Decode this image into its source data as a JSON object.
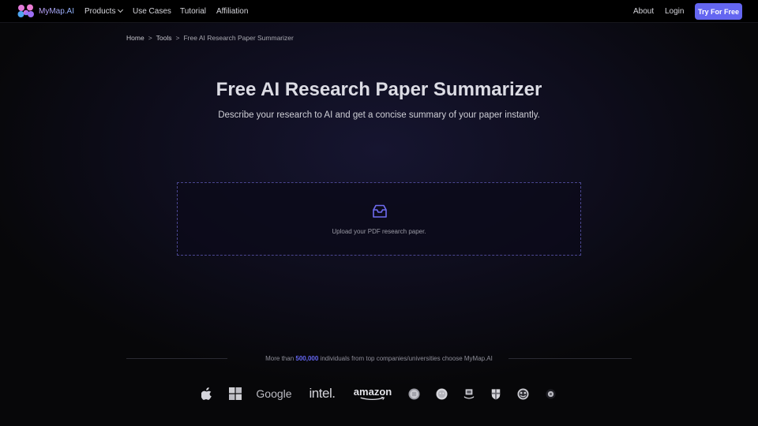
{
  "nav": {
    "brand": "MyMap.AI",
    "links": [
      "Products",
      "Use Cases",
      "Tutorial",
      "Affiliation"
    ],
    "right_links": [
      "About",
      "Login"
    ],
    "cta": "Try For Free",
    "accent": "#6466f1"
  },
  "breadcrumb": {
    "items": [
      "Home",
      "Tools",
      "Free AI Research Paper Summarizer"
    ],
    "separator": ">"
  },
  "hero": {
    "title": "Free AI Research Paper Summarizer",
    "subtitle": "Describe your research to AI and get a concise summary of your paper instantly."
  },
  "upload": {
    "icon": "inbox-icon",
    "label": "Upload your PDF research paper."
  },
  "trust": {
    "prefix": "More than",
    "count": "500,000",
    "suffix": "individuals from top companies/universities choose MyMap.AI",
    "logos": [
      "apple",
      "microsoft",
      "Google",
      "intel",
      "amazon",
      "university-seal-1",
      "university-seal-2",
      "university-crest-3",
      "university-shield-4",
      "university-seal-5",
      "university-seal-6"
    ],
    "google_text": "Google",
    "intel_text": "intel.",
    "amazon_text": "amazon"
  }
}
